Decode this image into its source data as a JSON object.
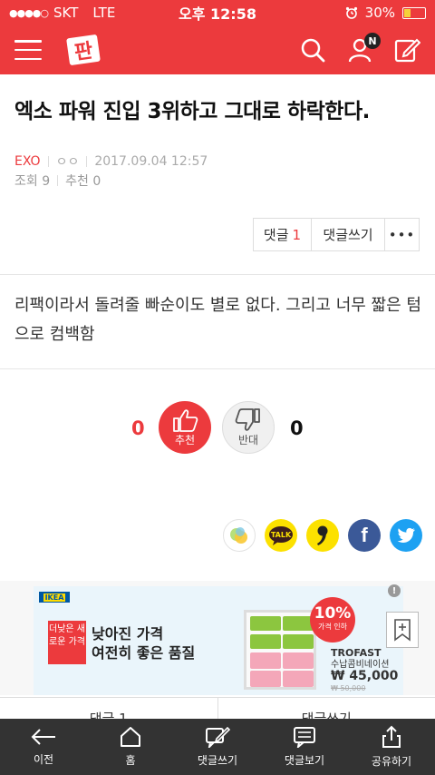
{
  "status_bar": {
    "signal": "●●●●○",
    "carrier": "SKT",
    "network": "LTE",
    "time": "오후 12:58",
    "battery_percent": "30%",
    "battery_level": 0.3,
    "icons": [
      "alarm-icon",
      "battery-icon"
    ]
  },
  "header": {
    "logo_text": "판",
    "notification_badge": "N",
    "icons": [
      "menu-icon",
      "search-icon",
      "user-icon",
      "edit-icon"
    ],
    "bg_color": "#ec3a3d"
  },
  "post": {
    "title": "엑소 파워 진입 3위하고 그대로 하락한다.",
    "category": "EXO",
    "author": "ㅇㅇ",
    "date": "2017.09.04 12:57",
    "views": "조회 9",
    "recommends": "추천 0",
    "body": "리팩이라서 돌려줄 빠순이도 별로 없다. 그리고 너무 짧은 텀으로 컴백함"
  },
  "actions": {
    "comment_label": "댓글",
    "comment_count": "1",
    "write_comment_label": "댓글쓰기",
    "more_label": "•••"
  },
  "vote": {
    "up_count": "0",
    "up_label": "추천",
    "down_label": "반대",
    "down_count": "0"
  },
  "share": {
    "icons": [
      "kakaostory-icon",
      "kakaotalk-icon",
      "quote-icon",
      "facebook-icon",
      "twitter-icon"
    ],
    "talk_label": "TALK",
    "facebook_label": "f"
  },
  "ad": {
    "brand": "IKEA",
    "tag": "더낮은 새로운 가격",
    "headline_1": "낮아진 가격",
    "headline_2": "여전히 좋은 품질",
    "discount": "10%",
    "discount_note": "가격 인하",
    "product_name": "TROFAST",
    "product_desc": "수납콤비네이션",
    "price": "₩ 45,000",
    "old_price": "₩ 50,000",
    "close": "!"
  },
  "lower_tabs": {
    "left": "댓글 1",
    "right": "댓글쓰기"
  },
  "bottom_bar": {
    "items": [
      {
        "label": "이전",
        "icon": "back-arrow-icon"
      },
      {
        "label": "홈",
        "icon": "home-icon"
      },
      {
        "label": "댓글쓰기",
        "icon": "write-comment-icon"
      },
      {
        "label": "댓글보기",
        "icon": "view-comments-icon"
      },
      {
        "label": "공유하기",
        "icon": "share-icon"
      }
    ]
  }
}
